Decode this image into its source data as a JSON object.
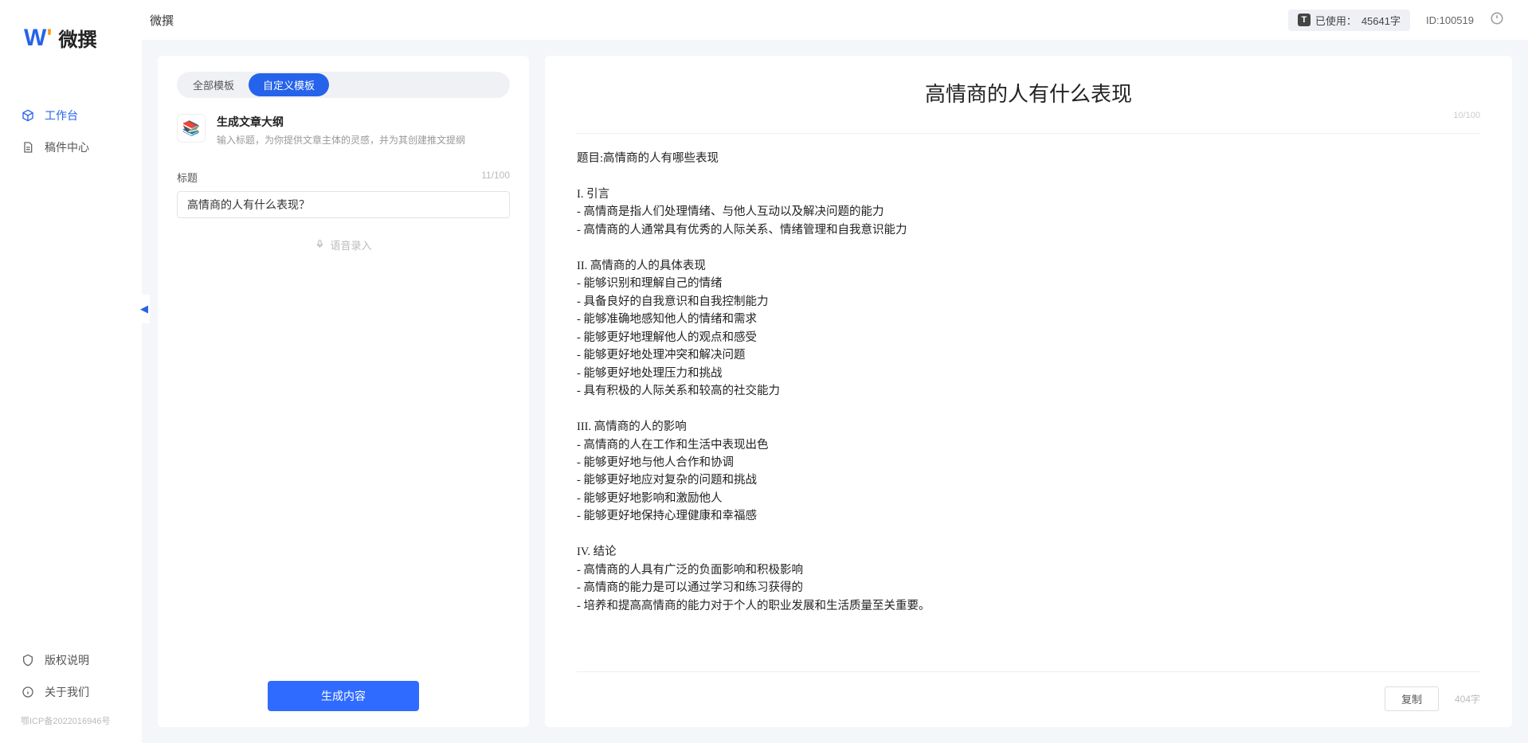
{
  "brand": {
    "name": "微撰"
  },
  "topbar": {
    "crumb": "微撰",
    "usage_prefix": "已使用：",
    "usage_value": "45641字",
    "id_label": "ID:",
    "id_value": "100519"
  },
  "sidebar": {
    "items": [
      {
        "label": "工作台"
      },
      {
        "label": "稿件中心"
      }
    ],
    "bottom": [
      {
        "label": "版权说明"
      },
      {
        "label": "关于我们"
      }
    ],
    "icp": "鄂ICP备2022016946号"
  },
  "left": {
    "tabs": [
      {
        "label": "全部模板"
      },
      {
        "label": "自定义模板"
      }
    ],
    "template": {
      "title": "生成文章大纲",
      "desc": "输入标题，为你提供文章主体的灵感，并为其创建推文提纲"
    },
    "field_label": "标题",
    "field_count": "11/100",
    "field_value": "高情商的人有什么表现？",
    "voice_label": "语音录入",
    "generate": "生成内容"
  },
  "right": {
    "title": "高情商的人有什么表现",
    "title_count": "10/100",
    "body": "题目:高情商的人有哪些表现\n\nI. 引言\n- 高情商是指人们处理情绪、与他人互动以及解决问题的能力\n- 高情商的人通常具有优秀的人际关系、情绪管理和自我意识能力\n\nII. 高情商的人的具体表现\n- 能够识别和理解自己的情绪\n- 具备良好的自我意识和自我控制能力\n- 能够准确地感知他人的情绪和需求\n- 能够更好地理解他人的观点和感受\n- 能够更好地处理冲突和解决问题\n- 能够更好地处理压力和挑战\n- 具有积极的人际关系和较高的社交能力\n\nIII. 高情商的人的影响\n- 高情商的人在工作和生活中表现出色\n- 能够更好地与他人合作和协调\n- 能够更好地应对复杂的问题和挑战\n- 能够更好地影响和激励他人\n- 能够更好地保持心理健康和幸福感\n\nIV. 结论\n- 高情商的人具有广泛的负面影响和积极影响\n- 高情商的能力是可以通过学习和练习获得的\n- 培养和提高高情商的能力对于个人的职业发展和生活质量至关重要。",
    "copy": "复制",
    "word_count": "404字"
  }
}
